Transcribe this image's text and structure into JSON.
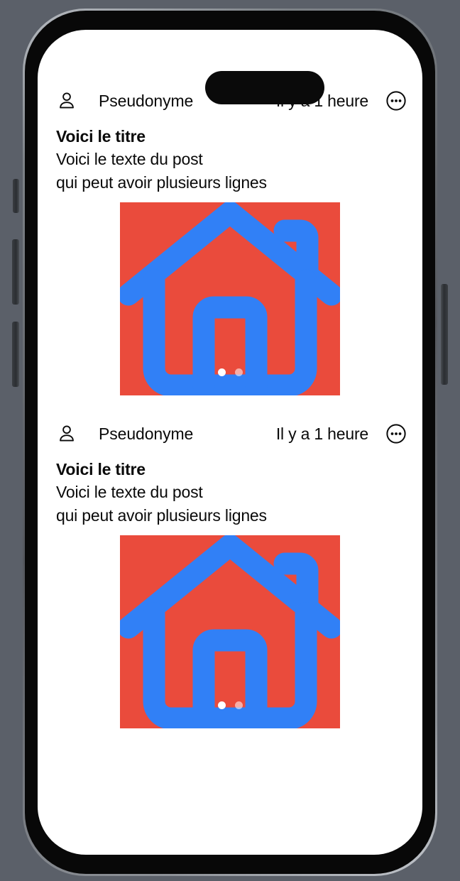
{
  "device": {
    "name": "iphone-mockup",
    "frame_color": "#55585e",
    "bezel_color": "#080808",
    "screen_background": "#ffffff",
    "page_background": "#5b6069",
    "buttons": [
      {
        "name": "mute-switch"
      },
      {
        "name": "volume-up-button"
      },
      {
        "name": "volume-down-button"
      },
      {
        "name": "power-button"
      }
    ]
  },
  "theme": {
    "text_color": "#0a0a0a",
    "media_background": "#ea4b3c",
    "media_icon_color": "#3180f6",
    "dot_active": "#ffffff",
    "dot_inactive": "rgba(255,255,255,0.55)"
  },
  "feed": {
    "posts": [
      {
        "avatar_icon": "person-icon",
        "author": "Pseudonyme",
        "timestamp": "Il y a 1 heure",
        "more_icon": "more-options-icon",
        "title": "Voici le titre",
        "text": "Voici le texte du post\n qui peut avoir plusieurs lignes",
        "media": {
          "icon": "house-icon",
          "background": "#ea4b3c",
          "icon_color": "#3180f6",
          "dots_total": 2,
          "dot_active_index": 0
        }
      },
      {
        "avatar_icon": "person-icon",
        "author": "Pseudonyme",
        "timestamp": "Il y a 1 heure",
        "more_icon": "more-options-icon",
        "title": "Voici le titre",
        "text": "Voici le texte du post\n qui peut avoir plusieurs lignes",
        "media": {
          "icon": "house-icon",
          "background": "#ea4b3c",
          "icon_color": "#3180f6",
          "dots_total": 2,
          "dot_active_index": 0
        }
      }
    ]
  }
}
